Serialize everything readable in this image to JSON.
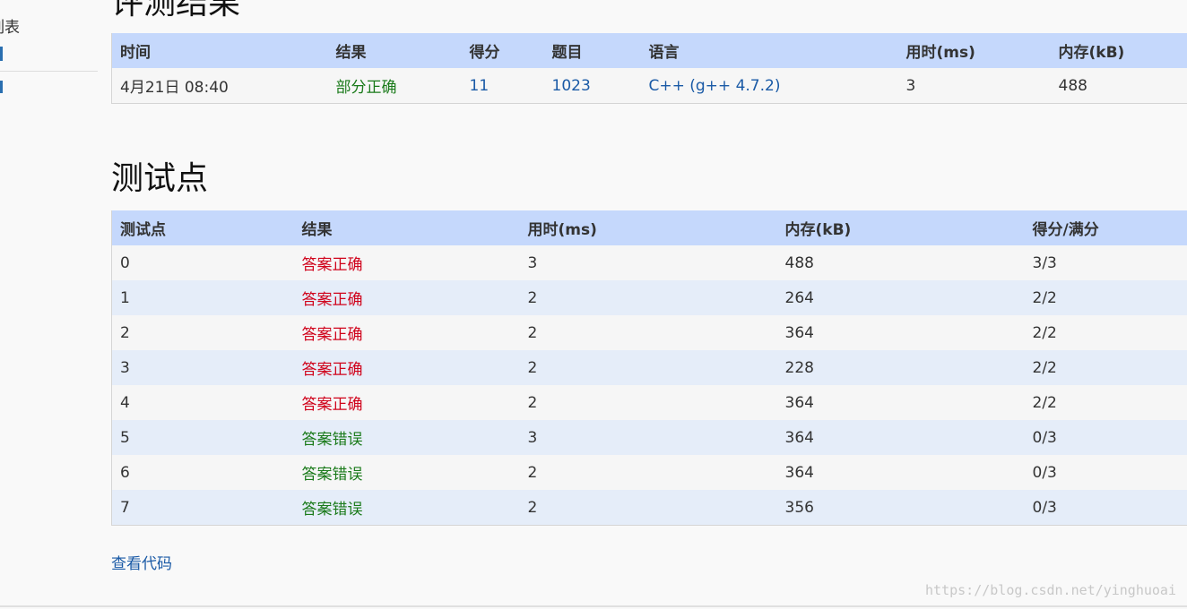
{
  "sidebar": {
    "item_1": "列表"
  },
  "result_section": {
    "heading": "评测结果",
    "columns": [
      "时间",
      "结果",
      "得分",
      "题目",
      "语言",
      "用时(ms)",
      "内存(kB)"
    ],
    "row": {
      "time": "4月21日 08:40",
      "result": "部分正确",
      "score": "11",
      "problem": "1023",
      "language": "C++ (g++ 4.7.2)",
      "time_ms": "3",
      "memory_kb": "488"
    }
  },
  "tests_section": {
    "heading": "测试点",
    "columns": [
      "测试点",
      "结果",
      "用时(ms)",
      "内存(kB)",
      "得分/满分"
    ],
    "rows": [
      {
        "id": "0",
        "result": "答案正确",
        "status": "correct",
        "time_ms": "3",
        "memory_kb": "488",
        "score": "3/3"
      },
      {
        "id": "1",
        "result": "答案正确",
        "status": "correct",
        "time_ms": "2",
        "memory_kb": "264",
        "score": "2/2"
      },
      {
        "id": "2",
        "result": "答案正确",
        "status": "correct",
        "time_ms": "2",
        "memory_kb": "364",
        "score": "2/2"
      },
      {
        "id": "3",
        "result": "答案正确",
        "status": "correct",
        "time_ms": "2",
        "memory_kb": "228",
        "score": "2/2"
      },
      {
        "id": "4",
        "result": "答案正确",
        "status": "correct",
        "time_ms": "2",
        "memory_kb": "364",
        "score": "2/2"
      },
      {
        "id": "5",
        "result": "答案错误",
        "status": "wrong",
        "time_ms": "3",
        "memory_kb": "364",
        "score": "0/3"
      },
      {
        "id": "6",
        "result": "答案错误",
        "status": "wrong",
        "time_ms": "2",
        "memory_kb": "364",
        "score": "0/3"
      },
      {
        "id": "7",
        "result": "答案错误",
        "status": "wrong",
        "time_ms": "2",
        "memory_kb": "356",
        "score": "0/3"
      }
    ]
  },
  "view_code_label": "查看代码",
  "watermark": "https://blog.csdn.net/yinghuoai",
  "colors": {
    "header_bg": "#c5d8fc",
    "row_even_bg": "#e5edf9",
    "correct": "#d0021b",
    "wrong": "#1a7a1a",
    "partial": "#1a7a1a",
    "link": "#1a5aa6"
  }
}
